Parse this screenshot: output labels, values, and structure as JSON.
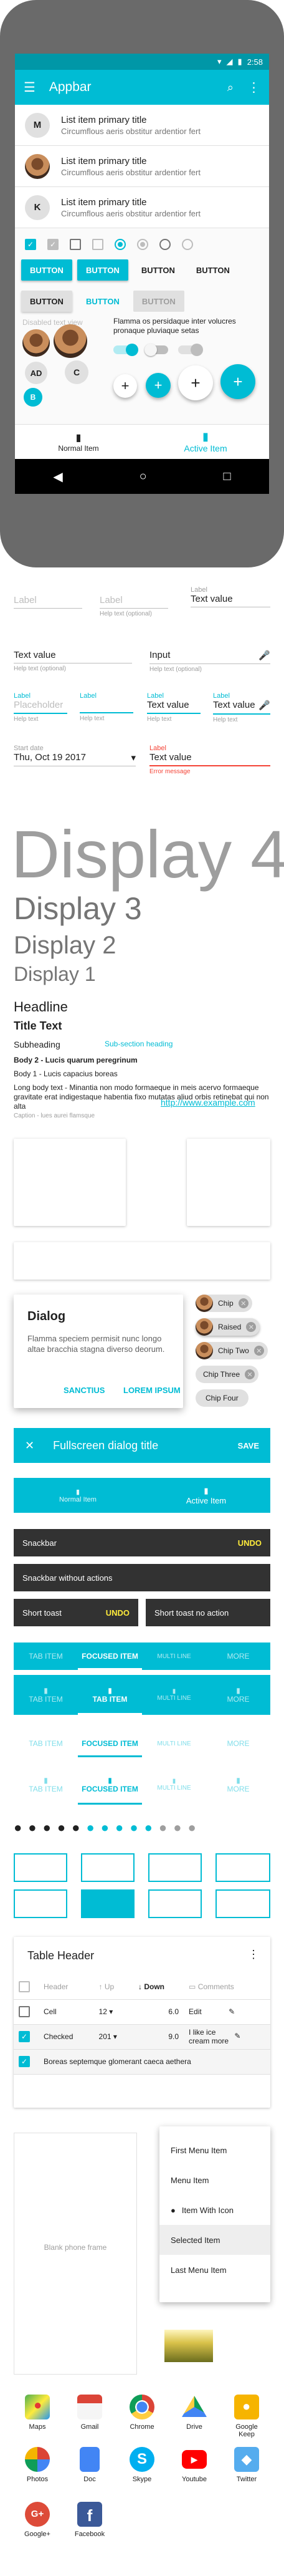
{
  "phone": {
    "status_time": "2:58",
    "appbar_title": "Appbar",
    "list": [
      {
        "avatar": "M",
        "primary": "List item primary title",
        "secondary": "Circumflous aeris obstitur ardentior fert"
      },
      {
        "avatar": "",
        "primary": "List item primary title",
        "secondary": "Circumflous aeris obstitur ardentior fert"
      },
      {
        "avatar": "K",
        "primary": "List item primary title",
        "secondary": "Circumflous aeris obstitur ardentior fert"
      }
    ],
    "buttons_row1": [
      "BUTTON",
      "BUTTON",
      "BUTTON",
      "BUTTON"
    ],
    "buttons_row2": [
      "BUTTON",
      "BUTTON",
      "BUTTON"
    ],
    "disabled_text": "Disabled text view",
    "flamma_text": "Flamma os persidaque inter volucres pronaque pluviaque setas",
    "avatar_letters": [
      "AD",
      "B",
      "C"
    ],
    "bottom_nav": [
      "Normal Item",
      "Active Item"
    ]
  },
  "fields": {
    "r1": [
      {
        "label": "",
        "value": "Label",
        "hint": true
      },
      {
        "label": "",
        "value": "Label",
        "hint": true,
        "help": "Help text (optional)"
      },
      {
        "label": "Label",
        "value": "Text value"
      }
    ],
    "r2": [
      {
        "value": "Text value",
        "help": "Help text (optional)"
      },
      {
        "value": "Input",
        "help": "Help text (optional)"
      }
    ],
    "r3": [
      {
        "label": "Label",
        "value": "Placeholder",
        "help": "Help text"
      },
      {
        "label": "Label",
        "value": "",
        "help": "Help text"
      },
      {
        "label": "Label",
        "value": "Text value",
        "help": "Help text"
      },
      {
        "label": "Label",
        "value": "Text value",
        "help": "Help text"
      }
    ],
    "r4": [
      {
        "label": "Start date",
        "value": "Thu, Oct 19 2017"
      },
      {
        "label": "Label",
        "value": "Text value",
        "help": "Error message"
      }
    ]
  },
  "typo": {
    "d4": "Display 4",
    "d3": "Display 3",
    "d2": "Display 2",
    "d1": "Display 1",
    "headline": "Headline",
    "title": "Title Text",
    "subheading": "Subheading",
    "subsection": "Sub-section heading",
    "body2": "Body 2 - Lucis quarum peregrinum",
    "body1": "Body 1 - Lucis capacius boreas",
    "long": "Long body text - Minantia non modo formaeque in meis acervo formaeque gravitate erat indigestaque habentia fixo mutatas aliud orbis retinebat qui non alta",
    "caption": "Caption - lues aurei flamsque",
    "link": "http://www.example.com"
  },
  "dialog": {
    "title": "Dialog",
    "body": "Flamma speciem permisit nunc longo altae bracchia stagna diverso deorum.",
    "actions": [
      "SANCTIUS",
      "LOREM IPSUM"
    ]
  },
  "chips": [
    "Chip",
    "Raised",
    "Chip Two",
    "Chip Three",
    "Chip Four"
  ],
  "fullscreen": {
    "title": "Fullscreen dialog title",
    "action": "SAVE"
  },
  "bnav2": [
    "Normal Item",
    "Active Item"
  ],
  "snackbars": {
    "s1": "Snackbar",
    "s1a": "UNDO",
    "s2": "Snackbar without actions",
    "t1": "Short toast",
    "t1a": "UNDO",
    "t2": "Short toast no action"
  },
  "tabs": {
    "item": "TAB ITEM",
    "focused": "FOCUSED ITEM",
    "multi": "MULTI LINE",
    "more": "MORE"
  },
  "table": {
    "title": "Table Header",
    "headers": [
      "Header",
      "Up",
      "Down",
      "Comments"
    ],
    "rows": [
      {
        "a": "Cell",
        "b": "12",
        "c": "6.0",
        "d": "Edit"
      },
      {
        "a": "Checked",
        "b": "201",
        "c": "9.0",
        "d": "I like ice cream more"
      },
      {
        "a": "Boreas septemque glomerant caeca aethera",
        "b": "",
        "c": "",
        "d": ""
      }
    ]
  },
  "phone_frame": "Blank phone frame",
  "menu": [
    "First Menu Item",
    "Menu Item",
    "Item With Icon",
    "Selected Item",
    "Last Menu Item"
  ],
  "apps": [
    "Maps",
    "Gmail",
    "Chrome",
    "Drive",
    "Google Keep",
    "Photos",
    "Doc",
    "Skype",
    "Youtube",
    "Twitter",
    "Google+",
    "Facebook"
  ]
}
